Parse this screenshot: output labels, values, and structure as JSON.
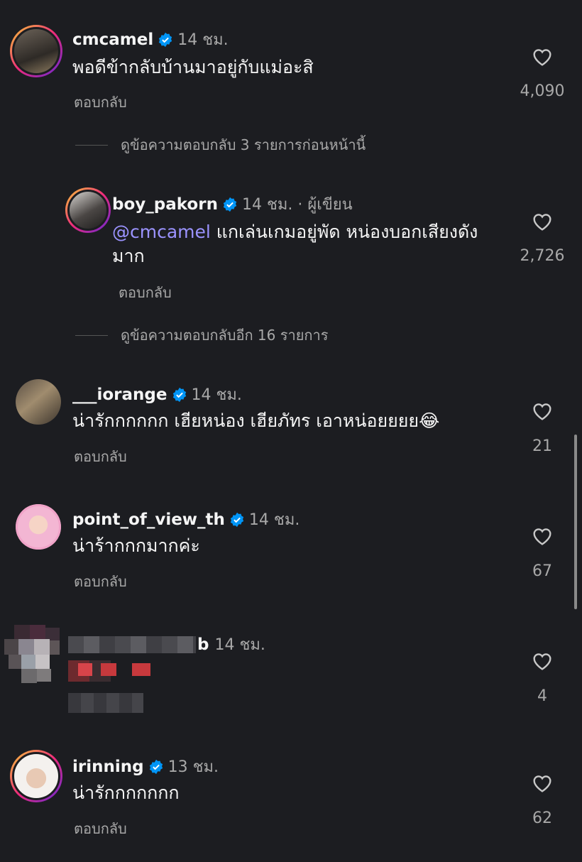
{
  "comments": [
    {
      "username": "cmcamel",
      "time": "14 ชม.",
      "text": "พอดีข้ากลับบ้านมาอยู่กับแม่อะสิ",
      "reply": "ตอบกลับ",
      "likes": "4,090"
    },
    {
      "view_previous": "ดูข้อความตอบกลับ 3 รายการก่อนหน้านี้"
    },
    {
      "username": "boy_pakorn",
      "time": "14 ชม. · ผู้เขียน",
      "mention": "@cmcamel",
      "text_line1": " แกเล่นเกมอยู่พัด หน่องบอกเสียงดัง",
      "text_line2": "มาก",
      "reply": "ตอบกลับ",
      "likes": "2,726"
    },
    {
      "view_more": "ดูข้อความตอบกลับอีก 16 รายการ"
    },
    {
      "username": "___iorange",
      "time": "14 ชม.",
      "text": "น่ารักกกกกก เฮียหน่อง เฮียภัทร เอาหน่อยยยย😂",
      "reply": "ตอบกลับ",
      "likes": "21"
    },
    {
      "username": "point_of_view_th",
      "time": "14 ชม.",
      "text": "น่าร้ากกกมากค่ะ",
      "reply": "ตอบกลับ",
      "likes": "67"
    },
    {
      "username_suffix": "b",
      "time": "14 ชม.",
      "likes": "4"
    },
    {
      "username": "irinning",
      "time": "13 ชม.",
      "text": "น่ารักกกกกกก",
      "reply": "ตอบกลับ",
      "likes": "62"
    }
  ],
  "colors": {
    "background": "#1c1d21",
    "verified": "#0095f6",
    "mention": "#9b93ff",
    "muted": "#a8a8a8"
  },
  "icons": [
    "verified-badge-icon",
    "heart-icon"
  ]
}
